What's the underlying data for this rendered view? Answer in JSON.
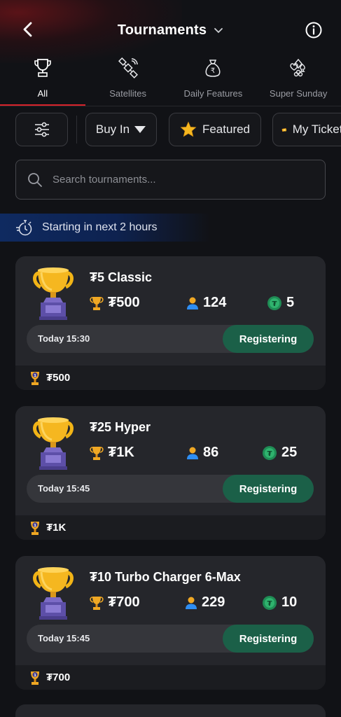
{
  "header": {
    "title": "Tournaments",
    "icons": {
      "back": "back-arrow-icon",
      "dropdown": "chevron-down-icon",
      "info": "info-icon"
    }
  },
  "tabs": [
    {
      "label": "All",
      "icon": "trophy-icon",
      "active": true
    },
    {
      "label": "Satellites",
      "icon": "satellite-icon",
      "active": false
    },
    {
      "label": "Daily Features",
      "icon": "money-bag-icon",
      "active": false
    },
    {
      "label": "Super Sunday",
      "icon": "card-suits-icon",
      "active": false
    }
  ],
  "filters": {
    "buy_in_label": "Buy In",
    "featured_label": "Featured",
    "tickets_label": "My Tickets"
  },
  "search": {
    "placeholder": "Search tournaments..."
  },
  "banner": {
    "text": "Starting in next 2 hours"
  },
  "tournaments": [
    {
      "name": "₮5 Classic",
      "prize": "₮500",
      "players": "124",
      "points": "5",
      "time": "Today 15:30",
      "status": "Registering",
      "footer_prize": "₮500"
    },
    {
      "name": "₮25 Hyper",
      "prize": "₮1K",
      "players": "86",
      "points": "25",
      "time": "Today 15:45",
      "status": "Registering",
      "footer_prize": "₮1K"
    },
    {
      "name": "₮10 Turbo Charger 6-Max",
      "prize": "₮700",
      "players": "229",
      "points": "10",
      "time": "Today 15:45",
      "status": "Registering",
      "footer_prize": "₮700"
    }
  ],
  "colors": {
    "background": "#111216",
    "card": "#25262b",
    "accent_red": "#d7232b",
    "register_green": "#1b6048",
    "banner_blue": "#0f2a60"
  }
}
